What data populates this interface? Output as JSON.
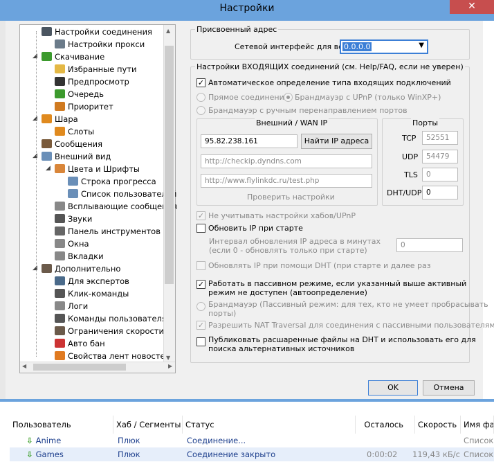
{
  "window": {
    "title": "Настройки",
    "close_glyph": "✕"
  },
  "tree": {
    "items": [
      {
        "label": "Настройки соединения",
        "icon": "network-icon",
        "color": "#4a5560"
      },
      {
        "label": "Настройки прокси",
        "icon": "proxy-icon",
        "color": "#6b7b8a"
      },
      {
        "label": "Скачивание",
        "icon": "download-icon",
        "color": "#3c9a2d"
      },
      {
        "label": "Избранные пути",
        "icon": "folder-icon",
        "color": "#e4b845"
      },
      {
        "label": "Предпросмотр",
        "icon": "preview-icon",
        "color": "#333333"
      },
      {
        "label": "Очередь",
        "icon": "queue-icon",
        "color": "#3c9a2d"
      },
      {
        "label": "Приоритет",
        "icon": "priority-icon",
        "color": "#d07a20"
      },
      {
        "label": "Шара",
        "icon": "share-icon",
        "color": "#e08a1e"
      },
      {
        "label": "Слоты",
        "icon": "slots-icon",
        "color": "#e08a1e"
      },
      {
        "label": "Сообщения",
        "icon": "messages-icon",
        "color": "#7a5a3a"
      },
      {
        "label": "Внешний вид",
        "icon": "appearance-icon",
        "color": "#6a8fb8"
      },
      {
        "label": "Цвета и Шрифты",
        "icon": "palette-icon",
        "color": "#d9863a"
      },
      {
        "label": "Строка прогресса",
        "icon": "progress-icon",
        "color": "#6a8fb8"
      },
      {
        "label": "Список пользователей",
        "icon": "userlist-icon",
        "color": "#6a8fb8"
      },
      {
        "label": "Всплывающие сообщения",
        "icon": "popup-icon",
        "color": "#888888"
      },
      {
        "label": "Звуки",
        "icon": "sound-icon",
        "color": "#555555"
      },
      {
        "label": "Панель инструментов",
        "icon": "toolbar-icon",
        "color": "#666666"
      },
      {
        "label": "Окна",
        "icon": "windows-icon",
        "color": "#888888"
      },
      {
        "label": "Вкладки",
        "icon": "tabs-icon",
        "color": "#888888"
      },
      {
        "label": "Дополнительно",
        "icon": "tools-icon",
        "color": "#6b5a4a"
      },
      {
        "label": "Для экспертов",
        "icon": "expert-icon",
        "color": "#4a6a8a"
      },
      {
        "label": "Клик-команды",
        "icon": "click-icon",
        "color": "#555555"
      },
      {
        "label": "Логи",
        "icon": "logs-icon",
        "color": "#888888"
      },
      {
        "label": "Команды пользователя",
        "icon": "usercmd-icon",
        "color": "#555555"
      },
      {
        "label": "Ограничения скорости",
        "icon": "speed-icon",
        "color": "#6b5a4a"
      },
      {
        "label": "Авто бан",
        "icon": "ban-icon",
        "color": "#cc3333"
      },
      {
        "label": "Свойства лент новостей",
        "icon": "rss-icon",
        "color": "#e07a20"
      }
    ]
  },
  "assigned": {
    "legend": "Присвоенный адрес",
    "iface_label": "Сетевой интерфейс для всех",
    "iface_value": "0.0.0.0"
  },
  "incoming": {
    "legend": "Настройки ВХОДЯЩИХ соединений (см. Help/FAQ, если не уверен)",
    "auto_detect": "Автоматическое определение типа входящих подключений",
    "direct": "Прямое соединение",
    "upnp": "Брандмауэр с UPnP (только WinXP+)",
    "manual": "Брандмауэр с ручным перенаправлением портов",
    "external": {
      "title": "Внешний / WAN IP",
      "ip": "95.82.238.161",
      "find_btn": "Найти IP адреса",
      "url1": "http://checkip.dyndns.com",
      "url2": "http://www.flylinkdc.ru/test.php",
      "check_link": "Проверить настройки"
    },
    "ports": {
      "title": "Порты",
      "tcp_label": "TCP",
      "tcp": "52551",
      "udp_label": "UDP",
      "udp": "54479",
      "tls_label": "TLS",
      "tls": "0",
      "dht_label": "DHT/UDP",
      "dht": "0"
    },
    "ignore_hubs": "Не учитывать настройки хабов/UPnP",
    "update_ip": "Обновить IP при старте",
    "interval_1": "Интервал обновления IP адреса в минутах",
    "interval_2": "(если 0 - обновлять только при старте)",
    "interval_value": "0",
    "dht_update": "Обновлять IP при помощи DHT (при старте и далее раз",
    "passive_1": "Работать в пассивном режиме, если указанный выше активный",
    "passive_2": "режим не доступен (автоопределение)",
    "fw_passive_1": "Брандмауэр (Пассивный режим: для тех, кто не умеет пробрасывать",
    "fw_passive_2": "порты)",
    "nat": "Разрешить NAT Traversal для соединения с пассивными пользователями",
    "publish_1": "Публиковать расшаренные файлы на DHT и использовать его для",
    "publish_2": "поиска альтернативных источников"
  },
  "buttons": {
    "ok": "OK",
    "cancel": "Отмена"
  },
  "table": {
    "headers": [
      "Пользователь",
      "Хаб / Сегменты",
      "Статус",
      "Осталось",
      "Скорость",
      "Имя фа"
    ],
    "rows": [
      {
        "user": "Anime",
        "hub": "Плюк",
        "status": "Соединение...",
        "left": "",
        "speed": "",
        "name": "Список"
      },
      {
        "user": "Games",
        "hub": "Плюк",
        "status": "Соединение закрыто",
        "left": "0:00:02",
        "speed": "119,43 кБ/с",
        "name": "Список"
      }
    ]
  }
}
